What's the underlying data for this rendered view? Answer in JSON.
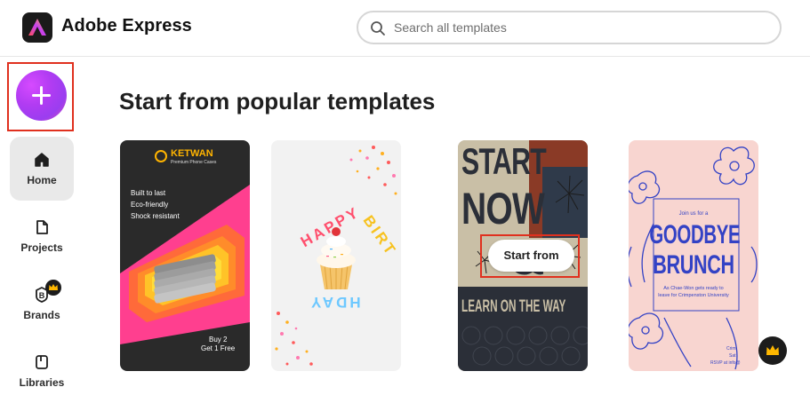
{
  "header": {
    "app_name": "Adobe Express",
    "logo_icon": "adobe-express-logo",
    "search": {
      "placeholder": "Search all templates",
      "value": ""
    }
  },
  "sidebar": {
    "create_icon": "plus-icon",
    "items": [
      {
        "label": "Home",
        "icon": "home-icon",
        "active": true
      },
      {
        "label": "Projects",
        "icon": "document-icon",
        "active": false
      },
      {
        "label": "Brands",
        "icon": "brand-icon",
        "active": false,
        "badge": "crown-icon"
      },
      {
        "label": "Libraries",
        "icon": "library-icon",
        "active": false
      }
    ]
  },
  "main": {
    "heading": "Start from popular templates",
    "templates": [
      {
        "name": "KETWAN",
        "subtitle": "Premium Phone Cases",
        "lines": [
          "Built to last",
          "Eco-friendly",
          "Shock resistant"
        ],
        "offer_line1": "Buy 2",
        "offer_line2": "Get 1 Free"
      },
      {
        "name": "HAPPY BIRTHDAY",
        "top_word": "HAPPY",
        "side_word": "BIRT",
        "bottom_word": "HDAY"
      },
      {
        "line1": "START",
        "line2": "NOW",
        "line3": "&",
        "line4": "LEARN ON THE WAY",
        "hover_button": "Start from"
      },
      {
        "kicker": "Join us for a",
        "title_line1": "GOODBYE",
        "title_line2": "BRUNCH",
        "body_line1": "As Chae-Won gets ready to",
        "body_line2": "leave for Crimpenston University",
        "footer_line1": "Crim",
        "footer_line2": "Sat",
        "footer_line3": "RSVP at info@",
        "premium_icon": "crown-icon"
      }
    ]
  },
  "colors": {
    "accent_red": "#e0301e",
    "create_button": "#b13cf2",
    "active_nav": "#e9e9e9"
  }
}
